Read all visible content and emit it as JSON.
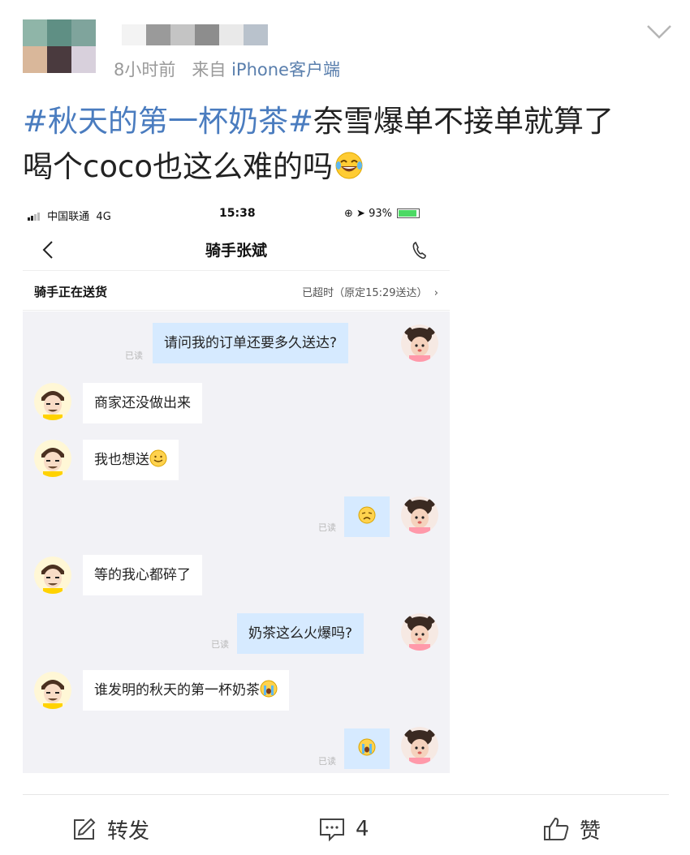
{
  "post": {
    "meta_time": "8小时前",
    "meta_from": "来自",
    "meta_source": "iPhone客户端",
    "hashtag": "#秋天的第一杯奶茶#",
    "text_line1_rest": "奈雪爆单不接单就算了",
    "text_line2": "喝个coco也这么难的吗",
    "emoji": "laugh-cry-emoji"
  },
  "screenshot": {
    "status": {
      "carrier": "中国联通",
      "network": "4G",
      "time": "15:38",
      "battery": "93%"
    },
    "nav": {
      "title": "骑手张斌"
    },
    "delivery": {
      "status": "骑手正在送货",
      "eta": "已超时（原定15:29送达）",
      "chevron": "›"
    },
    "messages": [
      {
        "from": "me",
        "text": "请问我的订单还要多久送达?",
        "read": "已读"
      },
      {
        "from": "rider",
        "text": "商家还没做出来"
      },
      {
        "from": "rider",
        "text": "我也想送",
        "emoji": "smile-emoji"
      },
      {
        "from": "me",
        "text": "",
        "emoji": "sad-emoji",
        "read": "已读"
      },
      {
        "from": "rider",
        "text": "等的我心都碎了"
      },
      {
        "from": "me",
        "text": "奶茶这么火爆吗?",
        "read": "已读"
      },
      {
        "from": "rider",
        "text": "谁发明的秋天的第一杯奶茶",
        "emoji": "cry-emoji"
      },
      {
        "from": "me",
        "text": "",
        "emoji": "cry-emoji",
        "read": "已读"
      }
    ]
  },
  "footer": {
    "repost_label": "转发",
    "comment_count": "4",
    "like_label": "赞"
  },
  "colors": {
    "hashtag": "#4a7cbf",
    "source": "#5a7fad",
    "my_bubble": "#d6eaff",
    "chat_bg": "#f2f2f6"
  }
}
